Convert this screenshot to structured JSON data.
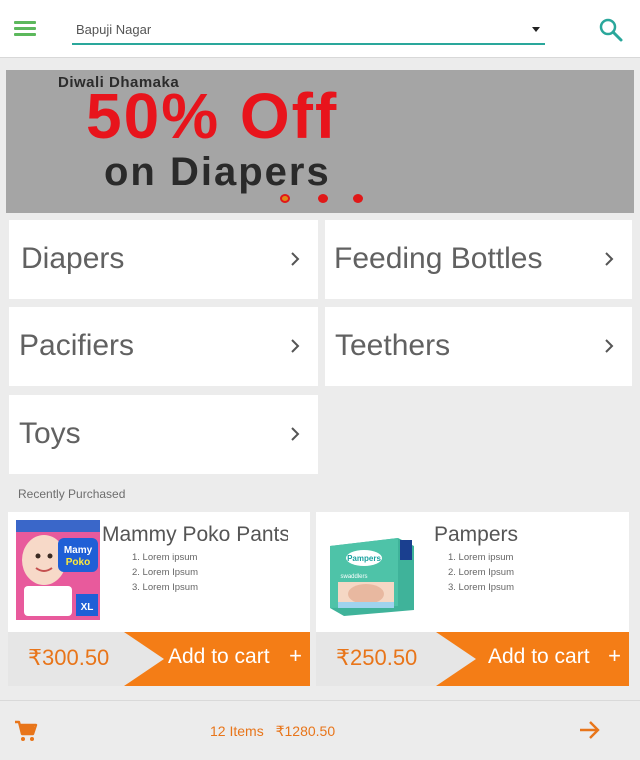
{
  "header": {
    "menu_icon": "hamburger-menu-icon",
    "location": "Bapuji Nagar",
    "search_icon": "search-icon",
    "accent_color": "#2aa79b",
    "menu_color": "#5cb85c"
  },
  "banner": {
    "tag": "Diwali Dhamaka",
    "headline": "50% Off",
    "subline": "on Diapers",
    "headline_color": "#e8141c",
    "slides": 3,
    "active_slide": 1
  },
  "categories": [
    {
      "label": "Diapers"
    },
    {
      "label": "Feeding Bottles"
    },
    {
      "label": "Pacifiers"
    },
    {
      "label": "Teethers"
    },
    {
      "label": "Toys"
    }
  ],
  "recent": {
    "title": "Recently Purchased",
    "products": [
      {
        "name": "Mammy Poko Pants",
        "features": [
          "1. Lorem ipsum",
          "2. Lorem Ipsum",
          "3. Lorem Ipsum"
        ],
        "price": "₹300.50",
        "cta": "Add to cart",
        "plus": "+"
      },
      {
        "name": "Pampers",
        "features": [
          "1. Lorem ipsum",
          "2. Lorem Ipsum",
          "3. Lorem Ipsum"
        ],
        "price": "₹250.50",
        "cta": "Add to cart",
        "plus": "+"
      }
    ]
  },
  "cart": {
    "icon": "shopping-cart-icon",
    "items": "12 Items",
    "total": "₹1280.50",
    "proceed_icon": "arrow-right-icon",
    "accent_color": "#e8751a"
  }
}
